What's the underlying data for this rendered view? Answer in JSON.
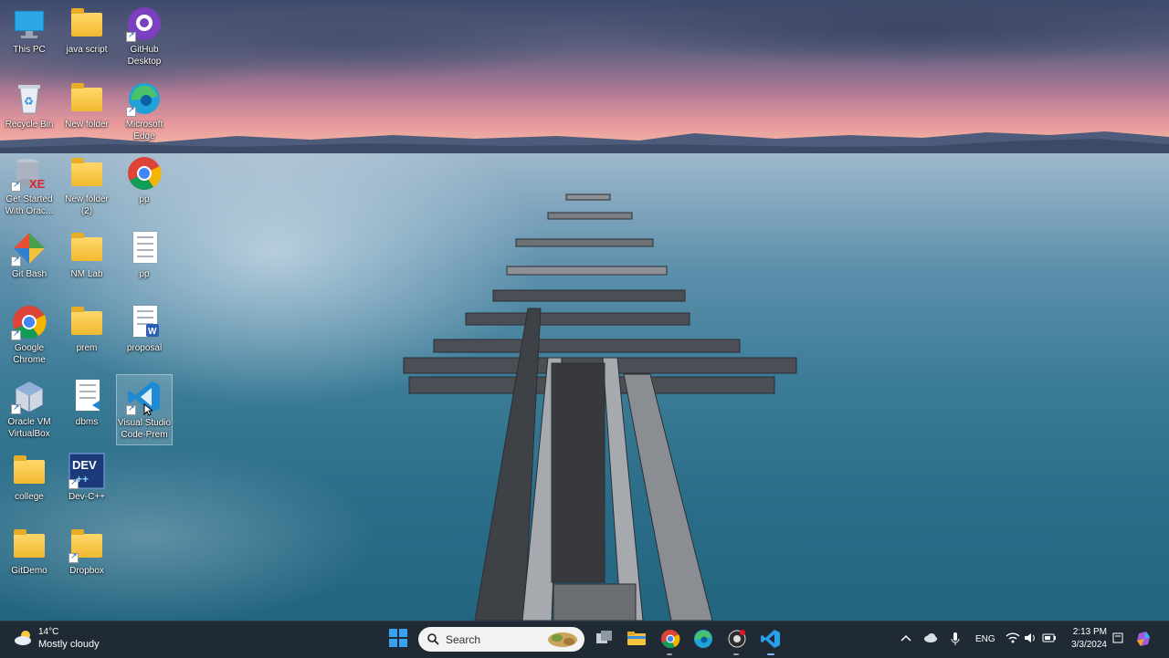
{
  "desktop": {
    "icons": [
      {
        "label": "This PC",
        "icon": "monitor-icon"
      },
      {
        "label": "java script",
        "icon": "folder-icon"
      },
      {
        "label": "GitHub Desktop",
        "icon": "github-icon"
      },
      {
        "label": "Recycle Bin",
        "icon": "recycle-bin-icon"
      },
      {
        "label": "New folder",
        "icon": "folder-icon"
      },
      {
        "label": "Microsoft Edge",
        "icon": "edge-icon"
      },
      {
        "label": "Get Started With Orac...",
        "icon": "oracle-xe-icon"
      },
      {
        "label": "New folder (2)",
        "icon": "folder-icon"
      },
      {
        "label": "pp",
        "icon": "chrome-icon"
      },
      {
        "label": "Git Bash",
        "icon": "git-bash-icon"
      },
      {
        "label": "NM Lab",
        "icon": "folder-icon"
      },
      {
        "label": "pp",
        "icon": "document-icon"
      },
      {
        "label": "Google Chrome",
        "icon": "chrome-icon"
      },
      {
        "label": "prem",
        "icon": "folder-icon"
      },
      {
        "label": "proposal",
        "icon": "word-document-icon"
      },
      {
        "label": "Oracle VM VirtualBox",
        "icon": "virtualbox-icon"
      },
      {
        "label": "dbms",
        "icon": "vscode-file-icon"
      },
      {
        "label": "Visual Studio Code-Prem",
        "icon": "vscode-icon"
      },
      {
        "label": "college",
        "icon": "folder-icon"
      },
      {
        "label": "Dev-C++",
        "icon": "devcpp-icon"
      },
      {
        "label": "GitDemo",
        "icon": "folder-icon"
      },
      {
        "label": "Dropbox",
        "icon": "folder-icon"
      }
    ]
  },
  "taskbar": {
    "weather": {
      "temp": "14°C",
      "desc": "Mostly cloudy"
    },
    "search_placeholder": "Search",
    "apps": [
      "start-icon",
      "search",
      "task-view-icon",
      "file-explorer-icon",
      "chrome-icon",
      "edge-icon",
      "github-icon",
      "vscode-icon"
    ],
    "tray": {
      "language": "ENG",
      "time": "2:13 PM",
      "date": "3/3/2024"
    }
  },
  "colors": {
    "taskbar_bg": "#1f2a35",
    "accent_blue": "#0078d4"
  }
}
